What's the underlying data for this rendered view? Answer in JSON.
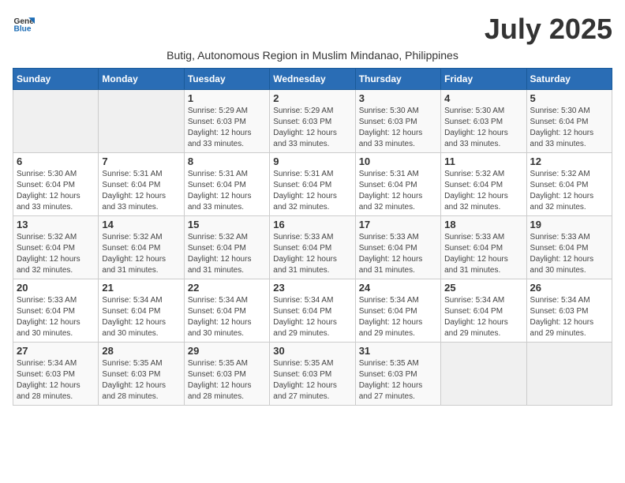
{
  "logo": {
    "line1": "General",
    "line2": "Blue"
  },
  "title": "July 2025",
  "subtitle": "Butig, Autonomous Region in Muslim Mindanao, Philippines",
  "weekdays": [
    "Sunday",
    "Monday",
    "Tuesday",
    "Wednesday",
    "Thursday",
    "Friday",
    "Saturday"
  ],
  "weeks": [
    [
      {
        "day": "",
        "sunrise": "",
        "sunset": "",
        "daylight": ""
      },
      {
        "day": "",
        "sunrise": "",
        "sunset": "",
        "daylight": ""
      },
      {
        "day": "1",
        "sunrise": "Sunrise: 5:29 AM",
        "sunset": "Sunset: 6:03 PM",
        "daylight": "Daylight: 12 hours and 33 minutes."
      },
      {
        "day": "2",
        "sunrise": "Sunrise: 5:29 AM",
        "sunset": "Sunset: 6:03 PM",
        "daylight": "Daylight: 12 hours and 33 minutes."
      },
      {
        "day": "3",
        "sunrise": "Sunrise: 5:30 AM",
        "sunset": "Sunset: 6:03 PM",
        "daylight": "Daylight: 12 hours and 33 minutes."
      },
      {
        "day": "4",
        "sunrise": "Sunrise: 5:30 AM",
        "sunset": "Sunset: 6:03 PM",
        "daylight": "Daylight: 12 hours and 33 minutes."
      },
      {
        "day": "5",
        "sunrise": "Sunrise: 5:30 AM",
        "sunset": "Sunset: 6:04 PM",
        "daylight": "Daylight: 12 hours and 33 minutes."
      }
    ],
    [
      {
        "day": "6",
        "sunrise": "Sunrise: 5:30 AM",
        "sunset": "Sunset: 6:04 PM",
        "daylight": "Daylight: 12 hours and 33 minutes."
      },
      {
        "day": "7",
        "sunrise": "Sunrise: 5:31 AM",
        "sunset": "Sunset: 6:04 PM",
        "daylight": "Daylight: 12 hours and 33 minutes."
      },
      {
        "day": "8",
        "sunrise": "Sunrise: 5:31 AM",
        "sunset": "Sunset: 6:04 PM",
        "daylight": "Daylight: 12 hours and 33 minutes."
      },
      {
        "day": "9",
        "sunrise": "Sunrise: 5:31 AM",
        "sunset": "Sunset: 6:04 PM",
        "daylight": "Daylight: 12 hours and 32 minutes."
      },
      {
        "day": "10",
        "sunrise": "Sunrise: 5:31 AM",
        "sunset": "Sunset: 6:04 PM",
        "daylight": "Daylight: 12 hours and 32 minutes."
      },
      {
        "day": "11",
        "sunrise": "Sunrise: 5:32 AM",
        "sunset": "Sunset: 6:04 PM",
        "daylight": "Daylight: 12 hours and 32 minutes."
      },
      {
        "day": "12",
        "sunrise": "Sunrise: 5:32 AM",
        "sunset": "Sunset: 6:04 PM",
        "daylight": "Daylight: 12 hours and 32 minutes."
      }
    ],
    [
      {
        "day": "13",
        "sunrise": "Sunrise: 5:32 AM",
        "sunset": "Sunset: 6:04 PM",
        "daylight": "Daylight: 12 hours and 32 minutes."
      },
      {
        "day": "14",
        "sunrise": "Sunrise: 5:32 AM",
        "sunset": "Sunset: 6:04 PM",
        "daylight": "Daylight: 12 hours and 31 minutes."
      },
      {
        "day": "15",
        "sunrise": "Sunrise: 5:32 AM",
        "sunset": "Sunset: 6:04 PM",
        "daylight": "Daylight: 12 hours and 31 minutes."
      },
      {
        "day": "16",
        "sunrise": "Sunrise: 5:33 AM",
        "sunset": "Sunset: 6:04 PM",
        "daylight": "Daylight: 12 hours and 31 minutes."
      },
      {
        "day": "17",
        "sunrise": "Sunrise: 5:33 AM",
        "sunset": "Sunset: 6:04 PM",
        "daylight": "Daylight: 12 hours and 31 minutes."
      },
      {
        "day": "18",
        "sunrise": "Sunrise: 5:33 AM",
        "sunset": "Sunset: 6:04 PM",
        "daylight": "Daylight: 12 hours and 31 minutes."
      },
      {
        "day": "19",
        "sunrise": "Sunrise: 5:33 AM",
        "sunset": "Sunset: 6:04 PM",
        "daylight": "Daylight: 12 hours and 30 minutes."
      }
    ],
    [
      {
        "day": "20",
        "sunrise": "Sunrise: 5:33 AM",
        "sunset": "Sunset: 6:04 PM",
        "daylight": "Daylight: 12 hours and 30 minutes."
      },
      {
        "day": "21",
        "sunrise": "Sunrise: 5:34 AM",
        "sunset": "Sunset: 6:04 PM",
        "daylight": "Daylight: 12 hours and 30 minutes."
      },
      {
        "day": "22",
        "sunrise": "Sunrise: 5:34 AM",
        "sunset": "Sunset: 6:04 PM",
        "daylight": "Daylight: 12 hours and 30 minutes."
      },
      {
        "day": "23",
        "sunrise": "Sunrise: 5:34 AM",
        "sunset": "Sunset: 6:04 PM",
        "daylight": "Daylight: 12 hours and 29 minutes."
      },
      {
        "day": "24",
        "sunrise": "Sunrise: 5:34 AM",
        "sunset": "Sunset: 6:04 PM",
        "daylight": "Daylight: 12 hours and 29 minutes."
      },
      {
        "day": "25",
        "sunrise": "Sunrise: 5:34 AM",
        "sunset": "Sunset: 6:04 PM",
        "daylight": "Daylight: 12 hours and 29 minutes."
      },
      {
        "day": "26",
        "sunrise": "Sunrise: 5:34 AM",
        "sunset": "Sunset: 6:03 PM",
        "daylight": "Daylight: 12 hours and 29 minutes."
      }
    ],
    [
      {
        "day": "27",
        "sunrise": "Sunrise: 5:34 AM",
        "sunset": "Sunset: 6:03 PM",
        "daylight": "Daylight: 12 hours and 28 minutes."
      },
      {
        "day": "28",
        "sunrise": "Sunrise: 5:35 AM",
        "sunset": "Sunset: 6:03 PM",
        "daylight": "Daylight: 12 hours and 28 minutes."
      },
      {
        "day": "29",
        "sunrise": "Sunrise: 5:35 AM",
        "sunset": "Sunset: 6:03 PM",
        "daylight": "Daylight: 12 hours and 28 minutes."
      },
      {
        "day": "30",
        "sunrise": "Sunrise: 5:35 AM",
        "sunset": "Sunset: 6:03 PM",
        "daylight": "Daylight: 12 hours and 27 minutes."
      },
      {
        "day": "31",
        "sunrise": "Sunrise: 5:35 AM",
        "sunset": "Sunset: 6:03 PM",
        "daylight": "Daylight: 12 hours and 27 minutes."
      },
      {
        "day": "",
        "sunrise": "",
        "sunset": "",
        "daylight": ""
      },
      {
        "day": "",
        "sunrise": "",
        "sunset": "",
        "daylight": ""
      }
    ]
  ]
}
